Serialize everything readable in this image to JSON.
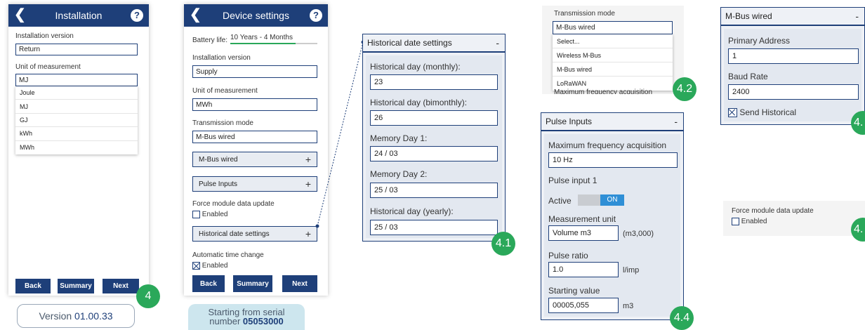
{
  "screen1": {
    "title": "Installation",
    "installation_version_label": "Installation version",
    "installation_version_value": "Return",
    "unit_label": "Unit of measurement",
    "unit_value": "MJ",
    "unit_options": [
      "Joule",
      "MJ",
      "GJ",
      "kWh",
      "MWh"
    ],
    "back_label": "Back",
    "summary_label": "Summary",
    "next_label": "Next",
    "badge": "4",
    "version_prefix": "Version ",
    "version_number": "01.00.33"
  },
  "screen2": {
    "title": "Device settings",
    "battery_label": "Battery life:",
    "battery_value": "10 Years - 4 Months",
    "battery_level": 0.75,
    "installation_version_label": "Installation version",
    "installation_version_value": "Supply",
    "unit_label": "Unit of measurement",
    "unit_value": "MWh",
    "transmission_label": "Transmission mode",
    "transmission_value": "M-Bus wired",
    "sections": [
      {
        "label": "M-Bus wired",
        "sign": "+"
      },
      {
        "label": "Pulse Inputs",
        "sign": "+"
      },
      {
        "label": "Historical date settings",
        "sign": "+"
      }
    ],
    "force_update_label": "Force module data update",
    "force_update_enabled": "Enabled",
    "auto_time_label": "Automatic time change",
    "auto_time_enabled": "Enabled",
    "back_label": "Back",
    "summary_label": "Summary",
    "next_label": "Next",
    "serial_line1": "Starting from serial",
    "serial_line2_prefix": "number ",
    "serial_number": "05053000"
  },
  "historical": {
    "title": "Historical date settings",
    "sign": "-",
    "fields": [
      {
        "label": "Historical day (monthly):",
        "value": "23"
      },
      {
        "label": "Historical day (bimonthly):",
        "value": "26"
      },
      {
        "label": "Memory Day 1:",
        "value": "24 / 03"
      },
      {
        "label": "Memory Day 2:",
        "value": "25 / 03"
      },
      {
        "label": "Historical day (yearly):",
        "value": "25 / 03"
      }
    ],
    "badge": "4.1"
  },
  "transmission": {
    "label": "Transmission mode",
    "value": "M-Bus wired",
    "options": [
      "Select...",
      "Wireless M-Bus",
      "M-Bus wired",
      "LoRaWAN"
    ],
    "cut_text": "Maximum frequency acquisition",
    "badge": "4.2"
  },
  "pulse": {
    "title": "Pulse Inputs",
    "sign": "-",
    "max_freq_label": "Maximum frequency acquisition",
    "max_freq_value": "10 Hz",
    "pulse_input_label": "Pulse input 1",
    "active_label": "Active",
    "active_toggle": "ON",
    "measurement_unit_label": "Measurement unit",
    "measurement_unit_value": "Volume m3",
    "measurement_unit_suffix": "(m3,000)",
    "pulse_ratio_label": "Pulse ratio",
    "pulse_ratio_value": "1.0",
    "pulse_ratio_unit": "l/imp",
    "starting_value_label": "Starting value",
    "starting_value_value": "00005,055",
    "starting_value_unit": "m3",
    "badge": "4.4"
  },
  "mbus": {
    "title": "M-Bus wired",
    "sign": "-",
    "primary_address_label": "Primary Address",
    "primary_address_value": "1",
    "baud_rate_label": "Baud Rate",
    "baud_rate_value": "2400",
    "send_historical_label": "Send Historical",
    "badge": "4."
  },
  "force": {
    "label": "Force module data update",
    "enabled": "Enabled",
    "badge": "4."
  },
  "colors": {
    "primary": "#1e3f79",
    "badge": "#2aa85a",
    "battery_bar": "#2aa85a"
  }
}
